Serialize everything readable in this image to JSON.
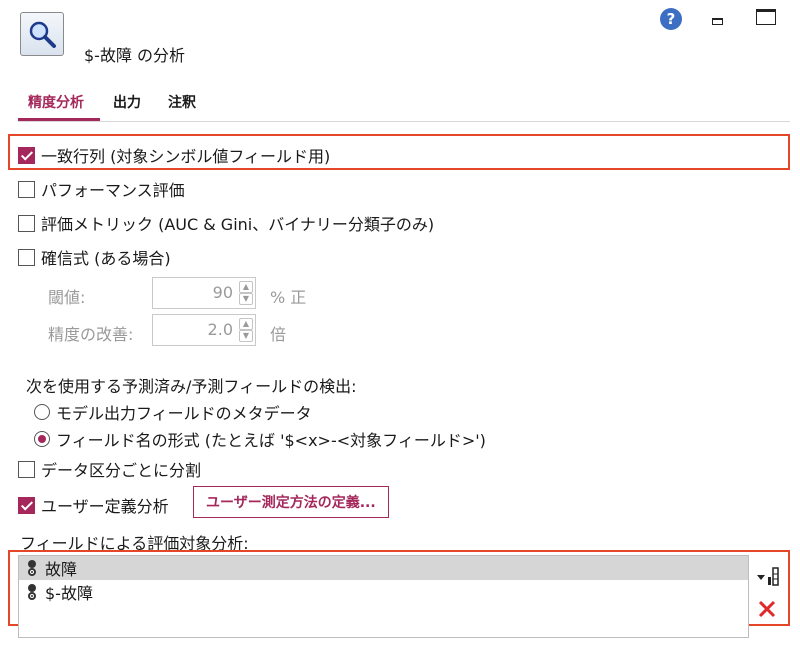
{
  "header": {
    "node_title": "$-故障 の分析",
    "node_icon": "magnifier-icon",
    "help_icon": "help-icon",
    "minimize_icon": "minimize-icon",
    "maximize_icon": "maximize-icon"
  },
  "tabs": [
    {
      "label": "精度分析",
      "active": true
    },
    {
      "label": "出力",
      "active": false
    },
    {
      "label": "注釈",
      "active": false
    }
  ],
  "options": {
    "coincidence_matrix": {
      "label": "一致行列 (対象シンボル値フィールド用)",
      "checked": true
    },
    "performance": {
      "label": "パフォーマンス評価",
      "checked": false
    },
    "eval_metrics": {
      "label": "評価メトリック (AUC & Gini、バイナリー分類子のみ)",
      "checked": false
    },
    "confidence": {
      "label": "確信式 (ある場合)",
      "checked": false
    }
  },
  "confidence_settings": {
    "threshold_label": "閾値:",
    "threshold_value": "90",
    "threshold_unit": "% 正",
    "improvement_label": "精度の改善:",
    "improvement_value": "2.0",
    "improvement_unit": "倍"
  },
  "detect": {
    "heading": "次を使用する予測済み/予測フィールドの検出:",
    "options": [
      {
        "label": "モデル出力フィールドのメタデータ",
        "checked": false
      },
      {
        "label": "フィールド名の形式 (たとえば '$<x>-<対象フィールド>')",
        "checked": true
      }
    ]
  },
  "partition": {
    "label": "データ区分ごとに分割",
    "checked": false
  },
  "user_defined": {
    "label": "ユーザー定義分析",
    "checked": true,
    "button_label": "ユーザー測定方法の定義..."
  },
  "evaluate_by": {
    "heading": "フィールドによる評価対象分析:",
    "fields": [
      {
        "name": "故障",
        "selected": true
      },
      {
        "name": "$-故障",
        "selected": false
      }
    ]
  },
  "colors": {
    "accent": "#a4285c",
    "highlight": "#e4462a"
  }
}
